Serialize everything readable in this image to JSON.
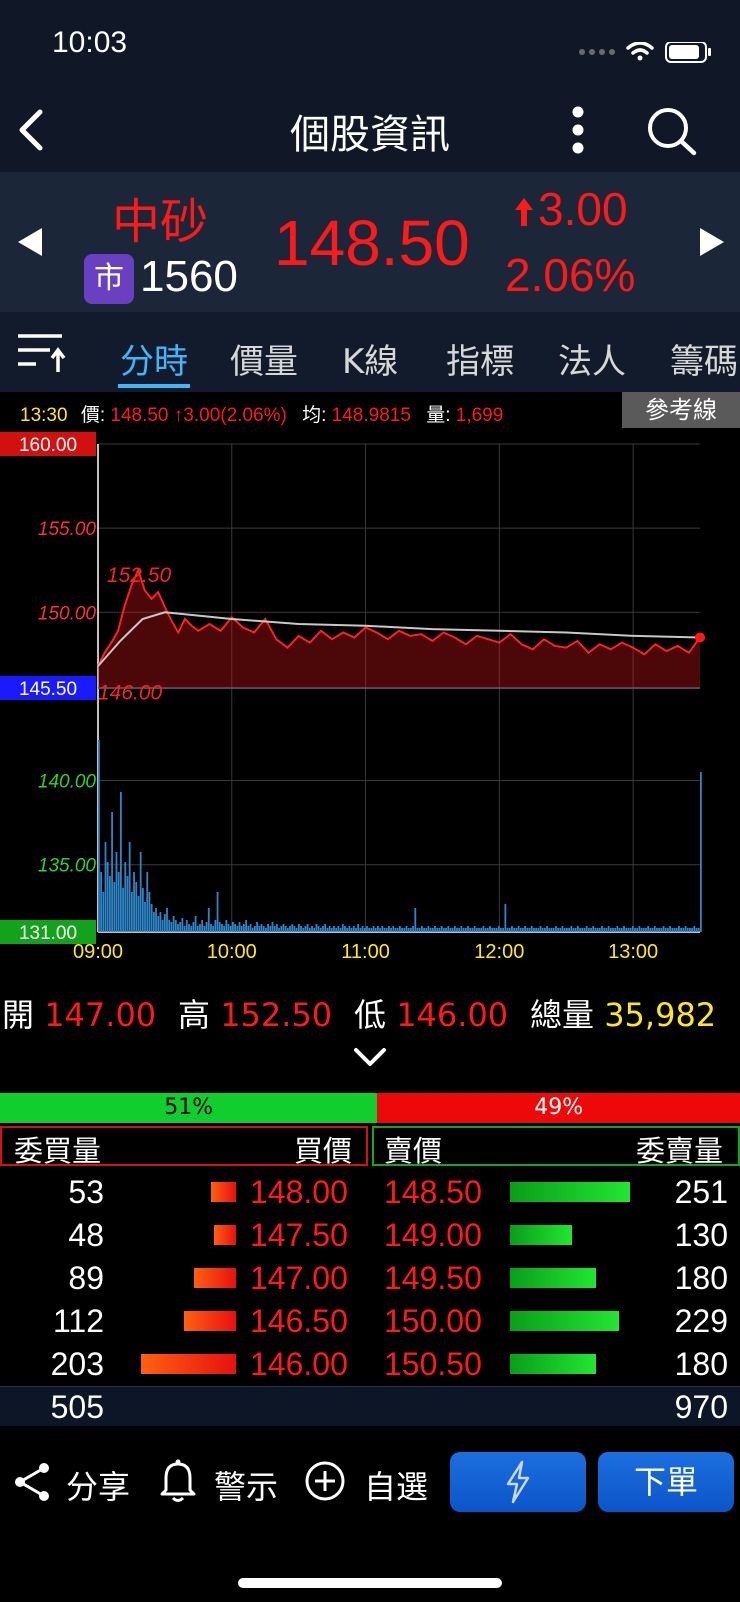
{
  "status_bar": {
    "time": "10:03"
  },
  "nav": {
    "title": "個股資訊"
  },
  "stock": {
    "name": "中砂",
    "market_badge": "市",
    "code": "1560",
    "price": "148.50",
    "change": "3.00",
    "change_pct": "2.06%"
  },
  "tabs": [
    "分時",
    "價量",
    "K線",
    "指標",
    "法人",
    "籌碼"
  ],
  "info_line": {
    "time": "13:30",
    "price_label": "價:",
    "price_value": "148.50",
    "change_value": "3.00(2.06%)",
    "avg_label": "均:",
    "avg_value": "148.9815",
    "volume_label": "量:",
    "volume_value": "1,699",
    "reference_button": "參考線"
  },
  "chart_data": {
    "type": "line",
    "y_tick_labels": [
      "160.00",
      "155.00",
      "150.00",
      "145.50",
      "140.00",
      "135.00",
      "131.00"
    ],
    "x_tick_labels": [
      "09:00",
      "10:00",
      "11:00",
      "12:00",
      "13:00"
    ],
    "ylim": [
      131,
      160
    ],
    "reference_price": 145.5,
    "annotations": {
      "high": "152.50",
      "low": "146.00"
    },
    "price_series": [
      [
        0,
        146.8
      ],
      [
        3,
        147.6
      ],
      [
        6,
        148.2
      ],
      [
        9,
        148.9
      ],
      [
        12,
        150.4
      ],
      [
        15,
        151.6
      ],
      [
        18,
        152.5
      ],
      [
        21,
        151.3
      ],
      [
        24,
        150.8
      ],
      [
        27,
        151.2
      ],
      [
        30,
        150.3
      ],
      [
        33,
        149.5
      ],
      [
        36,
        148.8
      ],
      [
        39,
        149.6
      ],
      [
        42,
        149.2
      ],
      [
        45,
        148.9
      ],
      [
        50,
        149.3
      ],
      [
        55,
        148.9
      ],
      [
        60,
        149.7
      ],
      [
        65,
        149.1
      ],
      [
        70,
        148.8
      ],
      [
        75,
        149.6
      ],
      [
        80,
        148.4
      ],
      [
        85,
        147.9
      ],
      [
        90,
        148.6
      ],
      [
        95,
        148.2
      ],
      [
        100,
        148.9
      ],
      [
        105,
        148.4
      ],
      [
        110,
        148.8
      ],
      [
        115,
        148.5
      ],
      [
        120,
        149.1
      ],
      [
        125,
        148.8
      ],
      [
        130,
        148.4
      ],
      [
        135,
        148.9
      ],
      [
        140,
        148.6
      ],
      [
        145,
        148.7
      ],
      [
        150,
        148.3
      ],
      [
        155,
        148.8
      ],
      [
        160,
        148.5
      ],
      [
        165,
        148.1
      ],
      [
        170,
        148.6
      ],
      [
        175,
        148.4
      ],
      [
        180,
        148.2
      ],
      [
        185,
        148.7
      ],
      [
        190,
        148.1
      ],
      [
        195,
        147.8
      ],
      [
        200,
        148.4
      ],
      [
        205,
        148.0
      ],
      [
        210,
        147.9
      ],
      [
        215,
        148.3
      ],
      [
        220,
        147.6
      ],
      [
        225,
        148.1
      ],
      [
        230,
        147.8
      ],
      [
        235,
        148.2
      ],
      [
        240,
        147.9
      ],
      [
        245,
        147.5
      ],
      [
        250,
        148.1
      ],
      [
        255,
        147.7
      ],
      [
        260,
        148.0
      ],
      [
        265,
        147.6
      ],
      [
        270,
        148.5
      ]
    ],
    "avg_series": [
      [
        0,
        146.8
      ],
      [
        10,
        148.3
      ],
      [
        20,
        149.6
      ],
      [
        30,
        150.0
      ],
      [
        45,
        149.8
      ],
      [
        60,
        149.6
      ],
      [
        90,
        149.3
      ],
      [
        120,
        149.2
      ],
      [
        150,
        149.0
      ],
      [
        180,
        148.9
      ],
      [
        210,
        148.8
      ],
      [
        240,
        148.6
      ],
      [
        270,
        148.5
      ]
    ],
    "volume_ymax": 100,
    "volume_series": [
      96,
      30,
      20,
      45,
      35,
      28,
      60,
      25,
      40,
      30,
      70,
      22,
      35,
      28,
      45,
      20,
      30,
      25,
      18,
      40,
      22,
      15,
      30,
      20,
      14,
      10,
      12,
      8,
      10,
      6,
      9,
      12,
      6,
      5,
      8,
      6,
      4,
      5,
      7,
      3,
      6,
      4,
      3,
      5,
      8,
      3,
      4,
      6,
      3,
      5,
      12,
      4,
      3,
      6,
      20,
      5,
      4,
      3,
      6,
      4,
      3,
      5,
      4,
      3,
      5,
      3,
      4,
      6,
      3,
      4,
      2,
      3,
      5,
      3,
      4,
      3,
      2,
      4,
      3,
      5,
      3,
      4,
      2,
      3,
      4,
      3,
      2,
      3,
      4,
      3,
      2,
      4,
      3,
      2,
      3,
      4,
      2,
      3,
      2,
      4,
      3,
      2,
      3,
      4,
      2,
      3,
      2,
      3,
      2,
      3,
      2,
      4,
      3,
      2,
      3,
      2,
      3,
      2,
      4,
      2,
      3,
      2,
      3,
      2,
      2,
      3,
      2,
      3,
      2,
      3,
      2,
      2,
      3,
      2,
      3,
      2,
      2,
      3,
      2,
      2,
      3,
      2,
      2,
      3,
      12,
      2,
      2,
      3,
      2,
      2,
      3,
      2,
      2,
      3,
      2,
      2,
      3,
      2,
      2,
      3,
      2,
      2,
      3,
      2,
      2,
      3,
      2,
      2,
      3,
      2,
      2,
      3,
      2,
      2,
      2,
      3,
      2,
      2,
      3,
      2,
      2,
      2,
      3,
      2,
      2,
      14,
      2,
      2,
      3,
      2,
      2,
      3,
      2,
      2,
      3,
      2,
      2,
      3,
      2,
      2,
      2,
      3,
      2,
      2,
      3,
      2,
      2,
      2,
      3,
      2,
      2,
      3,
      2,
      2,
      2,
      3,
      2,
      2,
      3,
      2,
      2,
      2,
      3,
      2,
      2,
      3,
      2,
      2,
      2,
      3,
      2,
      2,
      3,
      2,
      2,
      2,
      3,
      2,
      2,
      3,
      2,
      2,
      2,
      3,
      2,
      2,
      3,
      2,
      2,
      2,
      3,
      2,
      2,
      3,
      2,
      2,
      2,
      3,
      2,
      2,
      3,
      2,
      2,
      2,
      3,
      2,
      2,
      3,
      2,
      2,
      2,
      3,
      2,
      2,
      80
    ]
  },
  "ohlc": {
    "open_label": "開",
    "open": "147.00",
    "high_label": "高",
    "high": "152.50",
    "low_label": "低",
    "low": "146.00",
    "volume_label": "總量",
    "volume": "35,982"
  },
  "order_book": {
    "buy_pct": "51%",
    "sell_pct": "49%",
    "buy_ratio": 0.51,
    "headers": {
      "bid_qty": "委買量",
      "bid_price": "買價",
      "ask_price": "賣價",
      "ask_qty": "委賣量"
    },
    "max_qty": 251,
    "rows": [
      {
        "bid_qty": "53",
        "bid_price": "148.00",
        "ask_price": "148.50",
        "ask_qty": "251",
        "bid_q": 53,
        "ask_q": 251
      },
      {
        "bid_qty": "48",
        "bid_price": "147.50",
        "ask_price": "149.00",
        "ask_qty": "130",
        "bid_q": 48,
        "ask_q": 130
      },
      {
        "bid_qty": "89",
        "bid_price": "147.00",
        "ask_price": "149.50",
        "ask_qty": "180",
        "bid_q": 89,
        "ask_q": 180
      },
      {
        "bid_qty": "112",
        "bid_price": "146.50",
        "ask_price": "150.00",
        "ask_qty": "229",
        "bid_q": 112,
        "ask_q": 229
      },
      {
        "bid_qty": "203",
        "bid_price": "146.00",
        "ask_price": "150.50",
        "ask_qty": "180",
        "bid_q": 203,
        "ask_q": 180
      }
    ],
    "total_bid": "505",
    "total_ask": "970"
  },
  "bottom_bar": {
    "share": "分享",
    "alert": "警示",
    "watchlist": "自選",
    "order": "下單"
  }
}
